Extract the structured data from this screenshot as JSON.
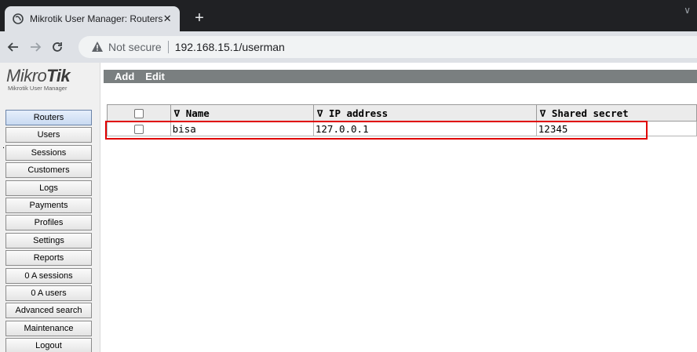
{
  "browser": {
    "tab_title": "Mikrotik User Manager: Routers",
    "tab_close": "✕",
    "new_tab": "+",
    "tab_menu": "∨",
    "address": {
      "security_label": "Not secure",
      "url": "192.168.15.1/userman"
    }
  },
  "logo": {
    "word_light": "Mikro",
    "word_bold": "Tik",
    "subtitle": "Mikrotik User Manager"
  },
  "menu": {
    "items": [
      {
        "label": "Routers",
        "active": true
      },
      {
        "label": "Users"
      },
      {
        "label": "Sessions"
      },
      {
        "label": "Customers"
      },
      {
        "label": "Logs"
      },
      {
        "label": "Payments"
      },
      {
        "label": "Profiles"
      },
      {
        "label": "Settings"
      },
      {
        "label": "Reports"
      },
      {
        "label": "0 A sessions"
      },
      {
        "label": "0 A users"
      },
      {
        "label": "Advanced search"
      },
      {
        "label": "Maintenance"
      },
      {
        "label": "Logout"
      }
    ]
  },
  "actions": {
    "add": "Add",
    "edit": "Edit"
  },
  "table": {
    "headers": {
      "name": "∇ Name",
      "ip": "∇ IP address",
      "secret": "∇ Shared secret"
    },
    "rows": [
      {
        "name": "bisa",
        "ip": "127.0.0.1",
        "secret": "12345"
      }
    ]
  },
  "footer_dot": ".",
  "colors": {
    "highlight": "#e00000",
    "actionbar": "#7a7f80",
    "warning": "#5f6368"
  }
}
